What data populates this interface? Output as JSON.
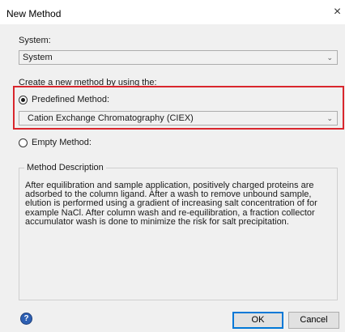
{
  "window": {
    "title": "New Method",
    "close_glyph": "×"
  },
  "system": {
    "label": "System:",
    "selected": "System",
    "chevron_icon": "chevron-down-icon"
  },
  "create_label": "Create a new method by using the:",
  "predefined": {
    "label": "Predefined Method:",
    "checked": true,
    "selected": "Cation Exchange Chromatography (CIEX)",
    "chevron_icon": "chevron-down-icon"
  },
  "empty": {
    "label": "Empty Method:",
    "checked": false
  },
  "description": {
    "legend": "Method Description",
    "text": "After equilibration and sample application, positively charged proteins are adsorbed to the column ligand. After a wash to remove unbound sample, elution is performed using a gradient of increasing salt concentration of for example NaCl. After column wash and re-equilibration, a fraction collector accumulator wash is done to minimize the risk for salt precipitation."
  },
  "buttons": {
    "ok": "OK",
    "cancel": "Cancel",
    "help_glyph": "?"
  },
  "colors": {
    "highlight": "#d9262d",
    "default_button_border": "#0078d7",
    "help_icon": "#2d5fb3"
  }
}
